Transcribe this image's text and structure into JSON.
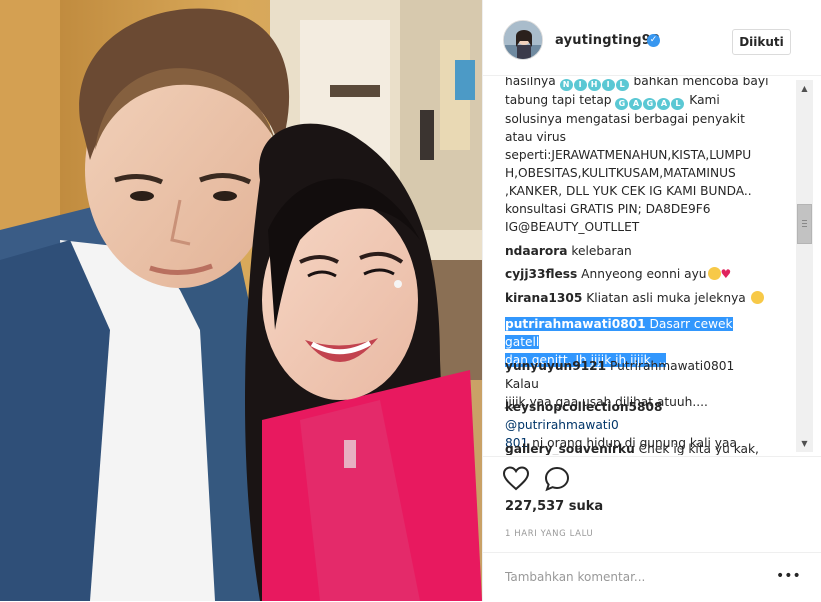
{
  "post": {
    "photo_alt": "selfie photo",
    "username": "ayutingting92",
    "verified_icon": "verified-badge-icon",
    "follow_label": "Diikuti",
    "caption_lines": [
      "hasilnya",
      "bahkan mencoba bayi",
      "tabung tapi tetap",
      "Kami",
      "solusinya mengatasi berbagai penyakit",
      "atau virus",
      "seperti:JERAWATMENAHUN,KISTA,LUMPU",
      "H,OBESITAS,KULITKUSAM,MATAMINUS",
      ",KANKER, DLL YUK CEK IG KAMI BUNDA..",
      "konsultasi GRATIS PIN; DA8DE9F6",
      "IG@BEAUTY_OUTLLET"
    ],
    "caption_badges": {
      "nihil": [
        "N",
        "I",
        "H",
        "I",
        "L"
      ],
      "gagal": [
        "G",
        "A",
        "G",
        "A",
        "L"
      ]
    },
    "comments": [
      {
        "user": "ndaarora",
        "text": "kelebaran"
      },
      {
        "user": "cyjj33fless",
        "text": "Annyeong eonni ayu"
      },
      {
        "user": "kirana1305",
        "text": "Kliatan asli muka jeleknya"
      },
      {
        "user": "putrirahmawati0801",
        "text_1": "Dasarr cewek gatell",
        "text_2": "dan genitt. Ih jijik ih jijik. .."
      },
      {
        "user": "yunyuyun9121",
        "text_1": "Putrirahmawati0801 Kalau",
        "text_2": "jijik yaa gaa usah dilihat atuuh...."
      },
      {
        "user": "keyshopcollection5808",
        "mention_1": "@putrirahmawati0",
        "mention_2": "801",
        "text_2": " ni orang hidup di gunung kali yaa"
      },
      {
        "user": "gallery_souvenirku",
        "text": "Chek ig kita yu kak,"
      }
    ],
    "likes": "227,537 suka",
    "time": "1 HARI YANG LALU",
    "add_comment_placeholder": "Tambahkan komentar...",
    "more_label": "•••"
  },
  "icons": {
    "like": "heart-outline-icon",
    "comment": "speech-bubble-icon",
    "scroll_up": "scroll-up-arrow-icon",
    "scroll_down": "scroll-down-arrow-icon"
  },
  "colors": {
    "selection": "#3297fd",
    "badge": "#5bc8d4",
    "verified": "#3897f0",
    "shirt": "#e8195f"
  }
}
